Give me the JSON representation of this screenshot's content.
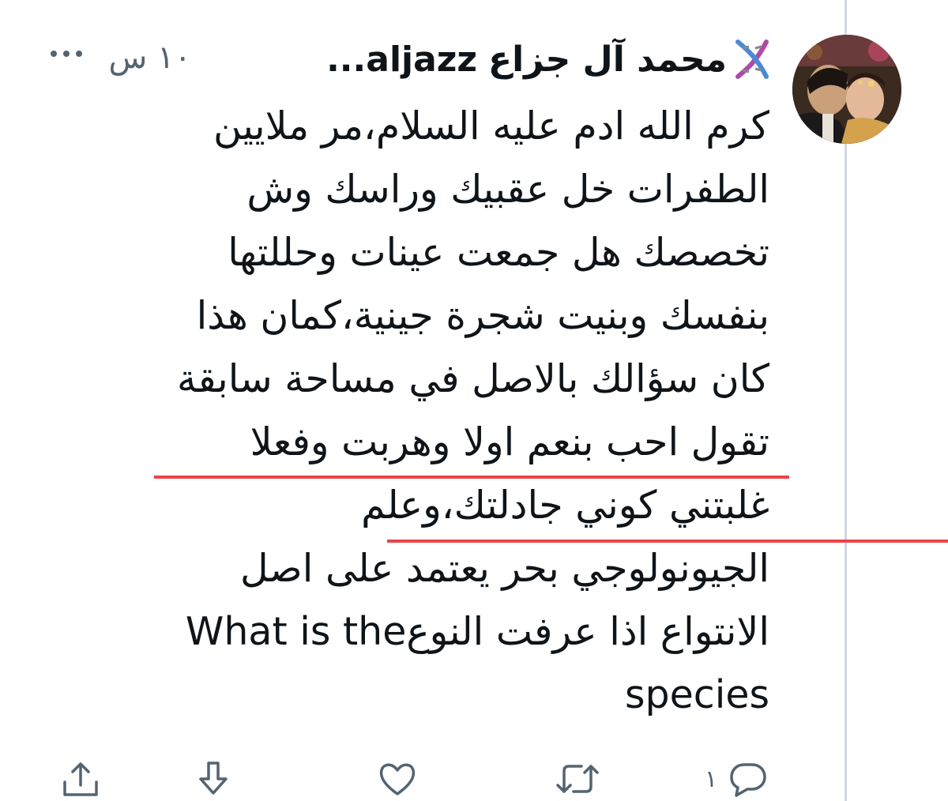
{
  "tweet": {
    "display_name": "محمد آل جزاع",
    "handle": "aljazz",
    "ellipsis": "...",
    "timestamp": "١٠ س",
    "text_lines": [
      "كرم الله ادم عليه السلام،مر ملايين",
      "الطفرات خل عقبيك وراسك وش",
      "تخصصك هل جمعت عينات وحللتها",
      "بنفسك وبنيت شجرة جينية،كمان هذا",
      "كان سؤالك بالاصل في مساحة سابقة",
      "تقول احب بنعم اولا وهربت وفعلا",
      "غلبتني كوني جادلتك،وعلم",
      "الجيونولوجي بحر يعتمد على اصل",
      "الانتواع اذا عرفت النوعWhat is the",
      "species"
    ]
  },
  "actions": {
    "reply_count": "١",
    "icons": [
      "reply-icon",
      "retweet-icon",
      "like-icon",
      "download-icon",
      "share-icon"
    ]
  },
  "colors": {
    "text": "#0f1419",
    "secondary": "#536471",
    "underline": "#e8454a",
    "thread_line": "#cfd9de"
  }
}
